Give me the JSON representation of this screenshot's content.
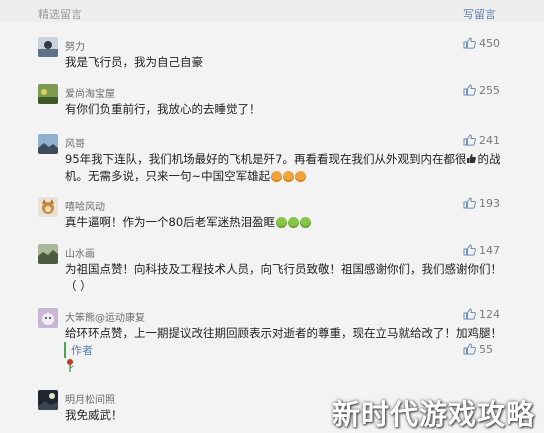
{
  "header": {
    "title": "精选留言",
    "write": "写留言"
  },
  "comments": [
    {
      "name": "努力",
      "likes": "450",
      "text": "我是飞行员，我为自己自豪"
    },
    {
      "name": "爱尚淘宝屋",
      "likes": "255",
      "text": "有你们负重前行，我放心的去睡觉了！"
    },
    {
      "name": "风哥",
      "likes": "241",
      "text": "95年我下连队，我们机场最好的飞机是歼7。再看看现在我们从外观到内在都很",
      "text_tail": "的战机。无需多说，只来一句~中国空军雄起"
    },
    {
      "name": "嘻哈风动",
      "likes": "193",
      "text": "真牛逼啊！作为一个80后老军迷热泪盈眶"
    },
    {
      "name": "山水画",
      "likes": "147",
      "text": "为祖国点赞！向科技及工程技术人员，向飞行员致敬！祖国感谢你们，我们感谢你们！（ ）"
    },
    {
      "name": "大笨熊@运动康复",
      "likes": "124",
      "text": "给环环点赞，上一期提议改往期回顾表示对逝者的尊重，现在立马就给改了！加鸡腿！",
      "reply": "作者",
      "reply_likes": "55"
    },
    {
      "name": "明月松间照",
      "likes": "",
      "text": "我免威武！"
    }
  ],
  "watermark": "新时代游戏攻略",
  "colors": {
    "background": "#f3f3f3",
    "link": "#5b7fb0",
    "author_bar": "#4da64d"
  }
}
